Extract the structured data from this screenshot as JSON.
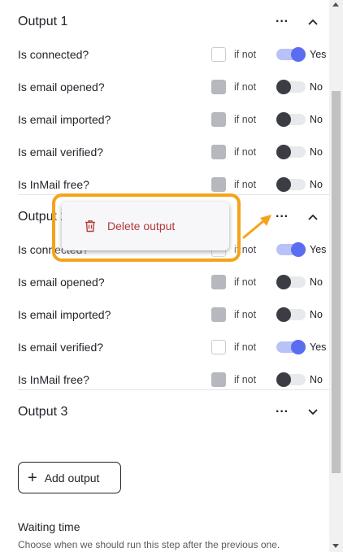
{
  "outputs": [
    {
      "title": "Output 1",
      "menu_icon": "dots-icon",
      "expanded": true,
      "rows": [
        {
          "label": "Is connected?",
          "checkbox": "on",
          "ifnot": "if not",
          "toggle": "yes",
          "toggle_label": "Yes"
        },
        {
          "label": "Is email opened?",
          "checkbox": "off",
          "ifnot": "if not",
          "toggle": "no",
          "toggle_label": "No"
        },
        {
          "label": "Is email imported?",
          "checkbox": "off",
          "ifnot": "if not",
          "toggle": "no",
          "toggle_label": "No"
        },
        {
          "label": "Is email verified?",
          "checkbox": "off",
          "ifnot": "if not",
          "toggle": "no",
          "toggle_label": "No"
        },
        {
          "label": "Is InMail free?",
          "checkbox": "off",
          "ifnot": "if not",
          "toggle": "no",
          "toggle_label": "No"
        }
      ]
    },
    {
      "title": "Output 2",
      "menu_icon": "dots-icon",
      "expanded": true,
      "rows": [
        {
          "label": "Is connected?",
          "checkbox": "on",
          "ifnot": "if not",
          "toggle": "yes",
          "toggle_label": "Yes"
        },
        {
          "label": "Is email opened?",
          "checkbox": "off",
          "ifnot": "if not",
          "toggle": "no",
          "toggle_label": "No"
        },
        {
          "label": "Is email imported?",
          "checkbox": "off",
          "ifnot": "if not",
          "toggle": "no",
          "toggle_label": "No"
        },
        {
          "label": "Is email verified?",
          "checkbox": "on",
          "ifnot": "if not",
          "toggle": "yes",
          "toggle_label": "Yes"
        },
        {
          "label": "Is InMail free?",
          "checkbox": "off",
          "ifnot": "if not",
          "toggle": "no",
          "toggle_label": "No"
        }
      ]
    },
    {
      "title": "Output 3",
      "menu_icon": "dots-icon",
      "expanded": false
    }
  ],
  "add_output": {
    "label": "Add output",
    "icon": "plus-icon"
  },
  "context_menu": {
    "label": "Delete output",
    "icon": "trash-icon",
    "color": "#b43a3a"
  },
  "waiting": {
    "title": "Waiting time",
    "description": "Choose when we should run this step after the previous one."
  },
  "colors": {
    "accent": "#5a6cf0",
    "highlight": "#f5a31a",
    "danger": "#b43a3a"
  }
}
